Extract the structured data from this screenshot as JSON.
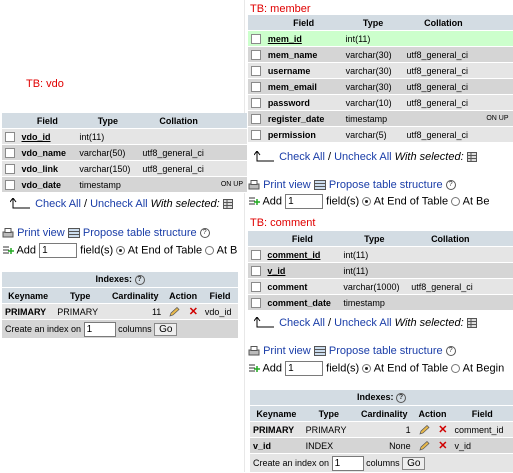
{
  "labels": {
    "vdo": "TB: vdo",
    "member": "TB: member",
    "comment": "TB: comment"
  },
  "columns": {
    "field": "Field",
    "type": "Type",
    "collation": "Collation"
  },
  "vdo": {
    "rows": [
      {
        "field": "vdo_id",
        "type": "int(11)",
        "collation": "",
        "extra": ""
      },
      {
        "field": "vdo_name",
        "type": "varchar(50)",
        "collation": "utf8_general_ci",
        "extra": ""
      },
      {
        "field": "vdo_link",
        "type": "varchar(150)",
        "collation": "utf8_general_ci",
        "extra": ""
      },
      {
        "field": "vdo_date",
        "type": "timestamp",
        "collation": "",
        "extra": "ON UP"
      }
    ]
  },
  "member": {
    "rows": [
      {
        "field": "mem_id",
        "type": "int(11)",
        "collation": "",
        "extra": ""
      },
      {
        "field": "mem_name",
        "type": "varchar(30)",
        "collation": "utf8_general_ci",
        "extra": ""
      },
      {
        "field": "username",
        "type": "varchar(30)",
        "collation": "utf8_general_ci",
        "extra": ""
      },
      {
        "field": "mem_email",
        "type": "varchar(30)",
        "collation": "utf8_general_ci",
        "extra": ""
      },
      {
        "field": "password",
        "type": "varchar(10)",
        "collation": "utf8_general_ci",
        "extra": ""
      },
      {
        "field": "register_date",
        "type": "timestamp",
        "collation": "",
        "extra": "ON UP"
      },
      {
        "field": "permission",
        "type": "varchar(5)",
        "collation": "utf8_general_ci",
        "extra": ""
      }
    ]
  },
  "comment": {
    "rows": [
      {
        "field": "comment_id",
        "type": "int(11)",
        "collation": ""
      },
      {
        "field": "v_id",
        "type": "int(11)",
        "collation": ""
      },
      {
        "field": "comment",
        "type": "varchar(1000)",
        "collation": "utf8_general_ci"
      },
      {
        "field": "comment_date",
        "type": "timestamp",
        "collation": ""
      }
    ]
  },
  "toolbar": {
    "check_all": "Check All",
    "slash": "/",
    "uncheck_all": "Uncheck All",
    "with_selected": "With selected:",
    "print_view": "Print view",
    "propose": "Propose table structure",
    "add": "Add",
    "fields": "field(s)",
    "at_end": "At End of Table",
    "at_b": "At B",
    "at_be": "At Be",
    "at_begin": "At Begin",
    "add_value": "1"
  },
  "indexes": {
    "caption": "Indexes:",
    "headers": {
      "keyname": "Keyname",
      "type": "Type",
      "cardinality": "Cardinality",
      "action": "Action",
      "field": "Field"
    },
    "vdo": [
      {
        "keyname": "PRIMARY",
        "type": "PRIMARY",
        "cardinality": "11",
        "field": "vdo_id"
      }
    ],
    "comment": [
      {
        "keyname": "PRIMARY",
        "type": "PRIMARY",
        "cardinality": "1",
        "field": "comment_id"
      },
      {
        "keyname": "v_id",
        "type": "INDEX",
        "cardinality": "None",
        "field": "v_id"
      }
    ],
    "create_label": "Create an index on",
    "columns_label": "columns",
    "create_value": "1",
    "go": "Go"
  }
}
